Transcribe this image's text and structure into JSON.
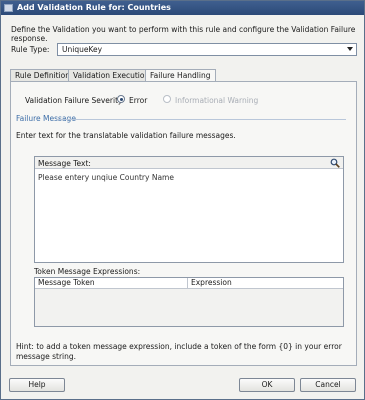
{
  "window": {
    "title": "Add Validation Rule for: Countries"
  },
  "description": "Define the Validation you want to perform with this rule and configure the Validation Failure response.",
  "rule_type": {
    "label": "Rule Type:",
    "value": "UniqueKey"
  },
  "tabs": [
    {
      "label": "Rule Definition"
    },
    {
      "label": "Validation Execution"
    },
    {
      "label": "Failure Handling",
      "active": true
    }
  ],
  "severity": {
    "label": "Validation Failure Severity",
    "options": [
      {
        "label": "Error",
        "selected": true,
        "enabled": true
      },
      {
        "label": "Informational Warning",
        "selected": false,
        "enabled": false
      }
    ]
  },
  "failure_message": {
    "header": "Failure Message",
    "instructions": "Enter text for the translatable validation failure messages.",
    "message_text_label": "Message Text:",
    "message_text": "Please entery unqiue Country Name"
  },
  "token_expressions": {
    "label": "Token Message Expressions:",
    "columns": [
      "Message Token",
      "Expression"
    ]
  },
  "hint": "Hint: to add a token message expression, include a token of the form {0} in your error message string.",
  "buttons": {
    "help": "Help",
    "ok": "OK",
    "cancel": "Cancel"
  }
}
